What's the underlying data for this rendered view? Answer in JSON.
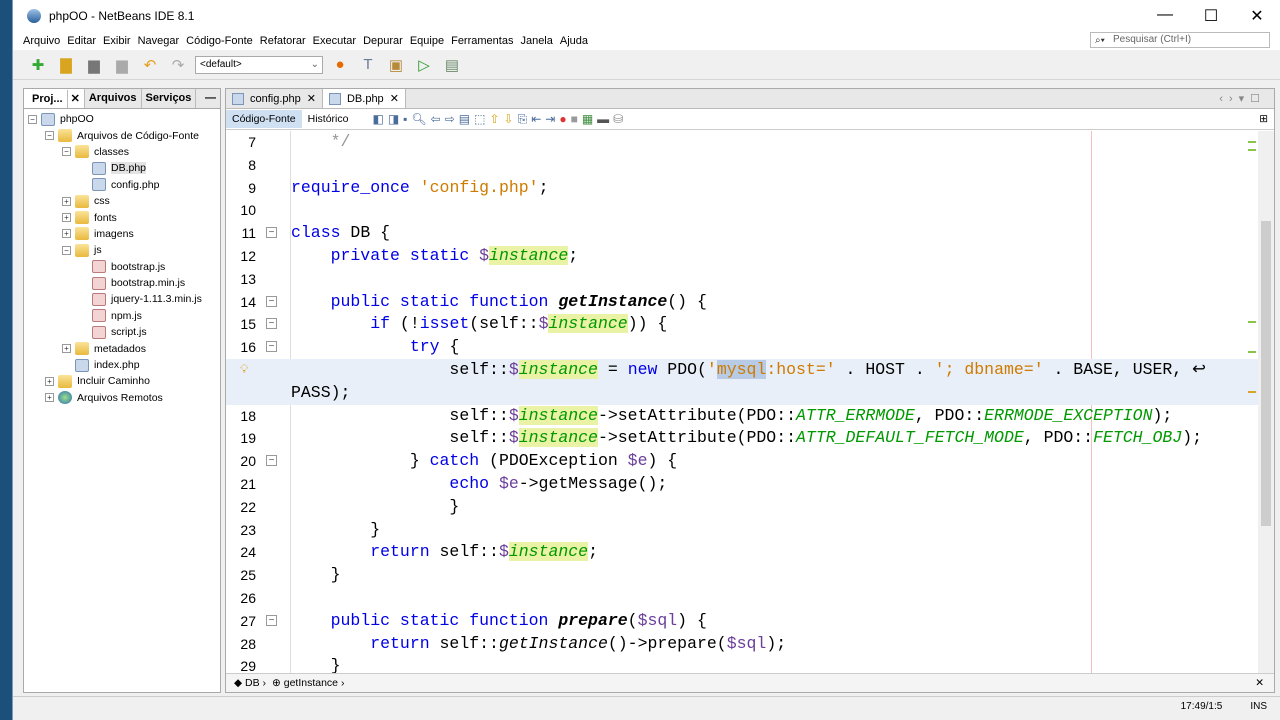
{
  "window": {
    "title": "phpOO - NetBeans IDE 8.1",
    "minimize": "—",
    "maximize": "☐",
    "close": "✕"
  },
  "menu": [
    "Arquivo",
    "Editar",
    "Exibir",
    "Navegar",
    "Código-Fonte",
    "Refatorar",
    "Executar",
    "Depurar",
    "Equipe",
    "Ferramentas",
    "Janela",
    "Ajuda"
  ],
  "search": {
    "placeholder": "Pesquisar (Ctrl+I)"
  },
  "toolbar": {
    "config": "<default>"
  },
  "left_panel": {
    "tabs": [
      "Proj...",
      "Arquivos",
      "Serviços"
    ],
    "minimize": "—",
    "tree": [
      {
        "label": "phpOO",
        "level": 0,
        "exp": "−",
        "icon": "php"
      },
      {
        "label": "Arquivos de Código-Fonte",
        "level": 1,
        "exp": "−",
        "icon": "fold"
      },
      {
        "label": "classes",
        "level": 2,
        "exp": "−",
        "icon": "fold"
      },
      {
        "label": "DB.php",
        "level": 3,
        "icon": "php",
        "selected": true
      },
      {
        "label": "config.php",
        "level": 3,
        "icon": "php"
      },
      {
        "label": "css",
        "level": 2,
        "exp": "+",
        "icon": "fold"
      },
      {
        "label": "fonts",
        "level": 2,
        "exp": "+",
        "icon": "fold"
      },
      {
        "label": "imagens",
        "level": 2,
        "exp": "+",
        "icon": "fold"
      },
      {
        "label": "js",
        "level": 2,
        "exp": "−",
        "icon": "fold"
      },
      {
        "label": "bootstrap.js",
        "level": 3,
        "icon": "js"
      },
      {
        "label": "bootstrap.min.js",
        "level": 3,
        "icon": "js"
      },
      {
        "label": "jquery-1.11.3.min.js",
        "level": 3,
        "icon": "js"
      },
      {
        "label": "npm.js",
        "level": 3,
        "icon": "js"
      },
      {
        "label": "script.js",
        "level": 3,
        "icon": "js"
      },
      {
        "label": "metadados",
        "level": 2,
        "exp": "+",
        "icon": "fold"
      },
      {
        "label": "index.php",
        "level": 2,
        "icon": "php"
      },
      {
        "label": "Incluir Caminho",
        "level": 1,
        "exp": "+",
        "icon": "fold"
      },
      {
        "label": "Arquivos Remotos",
        "level": 1,
        "exp": "+",
        "icon": "globe"
      }
    ]
  },
  "editor": {
    "tabs": [
      {
        "label": "config.php",
        "active": false
      },
      {
        "label": "DB.php",
        "active": true
      }
    ],
    "modes": [
      "Código-Fonte",
      "Histórico"
    ],
    "lines": [
      {
        "n": "7",
        "t": [
          [
            "cm",
            "    */"
          ]
        ]
      },
      {
        "n": "8",
        "t": []
      },
      {
        "n": "9",
        "t": [
          [
            "kw",
            "require_once "
          ],
          [
            "str",
            "'config.php'"
          ],
          [
            "",
            "; "
          ]
        ]
      },
      {
        "n": "10",
        "t": []
      },
      {
        "n": "11",
        "f": "−",
        "t": [
          [
            "kw",
            "class "
          ],
          [
            "",
            "DB {"
          ]
        ]
      },
      {
        "n": "12",
        "t": [
          [
            "kw",
            "    private static "
          ],
          [
            "var",
            "$"
          ],
          [
            "fld",
            "instance"
          ],
          [
            "",
            ";"
          ]
        ]
      },
      {
        "n": "13",
        "t": []
      },
      {
        "n": "14",
        "f": "−",
        "t": [
          [
            "kw",
            "    public static function "
          ],
          [
            "mth",
            "getInstance"
          ],
          [
            "",
            "() {"
          ]
        ]
      },
      {
        "n": "15",
        "f": "−",
        "t": [
          [
            "kw",
            "        if "
          ],
          [
            "",
            "(!"
          ],
          [
            "kw",
            "isset"
          ],
          [
            "",
            "(self::"
          ],
          [
            "var",
            "$"
          ],
          [
            "fld",
            "instance"
          ],
          [
            "",
            ")) {"
          ]
        ]
      },
      {
        "n": "16",
        "f": "−",
        "t": [
          [
            "kw",
            "            try "
          ],
          [
            "",
            "{"
          ]
        ]
      },
      {
        "n": "",
        "hl": true,
        "t": [
          [
            "",
            "                self::"
          ],
          [
            "var",
            "$"
          ],
          [
            "fld",
            "instance"
          ],
          [
            "",
            " = "
          ],
          [
            "kw",
            "new "
          ],
          [
            "",
            "PDO("
          ],
          [
            "str",
            "'"
          ],
          [
            "selx",
            "mysql"
          ],
          [
            "str",
            ":host='"
          ],
          [
            "",
            " . HOST . "
          ],
          [
            "str",
            "'; dbname='"
          ],
          [
            "",
            " . BASE, USER, ↩"
          ]
        ]
      },
      {
        "n": "",
        "hl": true,
        "t": [
          [
            "",
            "PASS);"
          ]
        ]
      },
      {
        "n": "18",
        "t": [
          [
            "",
            "                self::"
          ],
          [
            "var",
            "$"
          ],
          [
            "fld",
            "instance"
          ],
          [
            "",
            "->setAttribute(PDO::"
          ],
          [
            "cst",
            "ATTR_ERRMODE"
          ],
          [
            "",
            ", PDO::"
          ],
          [
            "cst",
            "ERRMODE_EXCEPTION"
          ],
          [
            "",
            ");"
          ]
        ]
      },
      {
        "n": "19",
        "t": [
          [
            "",
            "                self::"
          ],
          [
            "var",
            "$"
          ],
          [
            "fld",
            "instance"
          ],
          [
            "",
            "->setAttribute(PDO::"
          ],
          [
            "cst",
            "ATTR_DEFAULT_FETCH_MODE"
          ],
          [
            "",
            ", PDO::"
          ],
          [
            "cst",
            "FETCH_OBJ"
          ],
          [
            "",
            ");"
          ]
        ]
      },
      {
        "n": "20",
        "f": "−",
        "t": [
          [
            "",
            "            } "
          ],
          [
            "kw",
            "catch "
          ],
          [
            "",
            "(PDOException "
          ],
          [
            "var",
            "$e"
          ],
          [
            "",
            ") {"
          ]
        ]
      },
      {
        "n": "21",
        "t": [
          [
            "kw",
            "                echo "
          ],
          [
            "var",
            "$e"
          ],
          [
            "",
            "->getMessage();"
          ]
        ]
      },
      {
        "n": "22",
        "t": [
          [
            "",
            "                }"
          ]
        ]
      },
      {
        "n": "23",
        "t": [
          [
            "",
            "        }"
          ]
        ]
      },
      {
        "n": "24",
        "t": [
          [
            "kw",
            "        return "
          ],
          [
            "",
            "self::"
          ],
          [
            "var",
            "$"
          ],
          [
            "fld",
            "instance"
          ],
          [
            "",
            ";"
          ]
        ]
      },
      {
        "n": "25",
        "t": [
          [
            "",
            "    }"
          ]
        ]
      },
      {
        "n": "26",
        "t": []
      },
      {
        "n": "27",
        "f": "−",
        "t": [
          [
            "kw",
            "    public static function "
          ],
          [
            "mth",
            "prepare"
          ],
          [
            "",
            "("
          ],
          [
            "var",
            "$sql"
          ],
          [
            "",
            ") {"
          ]
        ]
      },
      {
        "n": "28",
        "t": [
          [
            "kw",
            "        return "
          ],
          [
            "",
            "self::"
          ],
          [
            "it",
            "getInstance"
          ],
          [
            "",
            "()->prepare("
          ],
          [
            "var",
            "$sql"
          ],
          [
            "",
            ");"
          ]
        ]
      },
      {
        "n": "29",
        "t": [
          [
            "",
            "    }"
          ]
        ]
      }
    ],
    "breadcrumb": [
      "DB",
      "getInstance"
    ]
  },
  "status": {
    "position": "17:49/1:5",
    "mode": "INS"
  }
}
